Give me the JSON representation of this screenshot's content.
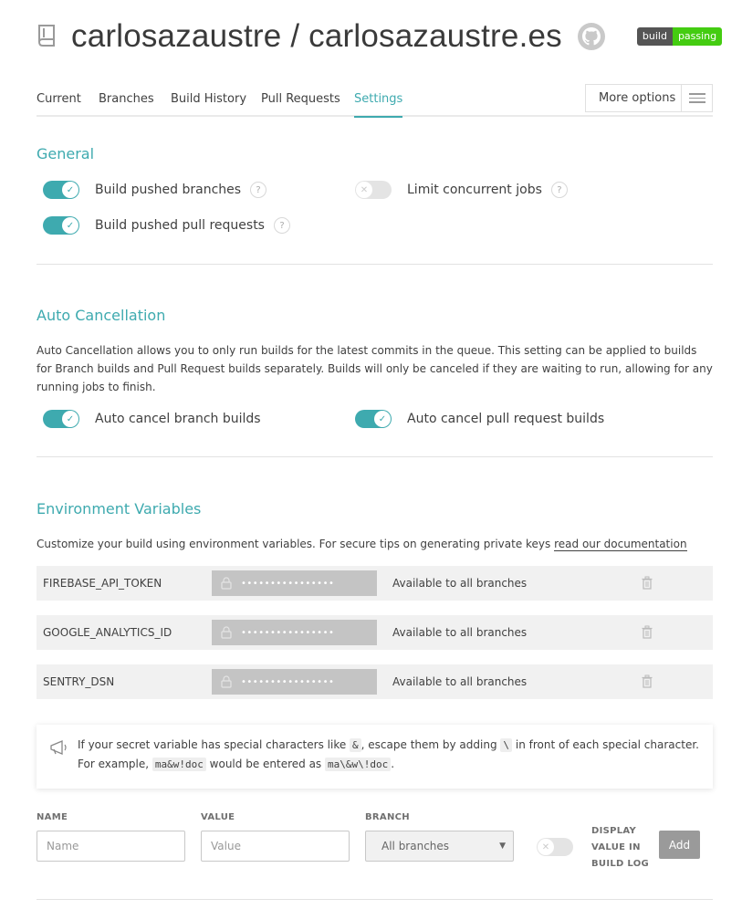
{
  "header": {
    "repo_title": "carlosazaustre / carlosazaustre.es",
    "badge_left": "build",
    "badge_right": "passing"
  },
  "tabs": [
    {
      "label": "Current"
    },
    {
      "label": "Branches"
    },
    {
      "label": "Build History"
    },
    {
      "label": "Pull Requests"
    },
    {
      "label": "Settings",
      "active": true
    }
  ],
  "more_options": "More options",
  "general": {
    "title": "General",
    "toggles": [
      {
        "label": "Build pushed branches",
        "on": true,
        "help": "?"
      },
      {
        "label": "Limit concurrent jobs",
        "on": false,
        "help": "?"
      },
      {
        "label": "Build pushed pull requests",
        "on": true,
        "help": "?"
      }
    ]
  },
  "auto_cancel": {
    "title": "Auto Cancellation",
    "description": "Auto Cancellation allows you to only run builds for the latest commits in the queue. This setting can be applied to builds for Branch builds and Pull Request builds separately. Builds will only be canceled if they are waiting to run, allowing for any running jobs to finish.",
    "toggles": [
      {
        "label": "Auto cancel branch builds",
        "on": true
      },
      {
        "label": "Auto cancel pull request builds",
        "on": true
      }
    ]
  },
  "env": {
    "title": "Environment Variables",
    "description": "Customize your build using environment variables. For secure tips on generating private keys",
    "doc_link": "read our documentation",
    "rows": [
      {
        "name": "FIREBASE_API_TOKEN",
        "value": "••••••••••••••••",
        "branch": "Available to all branches"
      },
      {
        "name": "GOOGLE_ANALYTICS_ID",
        "value": "••••••••••••••••",
        "branch": "Available to all branches"
      },
      {
        "name": "SENTRY_DSN",
        "value": "••••••••••••••••",
        "branch": "Available to all branches"
      }
    ],
    "tip": {
      "t1": "If your secret variable has special characters like",
      "c1": "&",
      "t2": ", escape them by adding",
      "c2": "\\",
      "t3": "in front of each special character. For example,",
      "c3": "ma&w!doc",
      "t4": "would be entered as",
      "c4": "ma\\&w\\!doc",
      "t5": "."
    },
    "form": {
      "name_label": "NAME",
      "name_placeholder": "Name",
      "value_label": "VALUE",
      "value_placeholder": "Value",
      "branch_label": "BRANCH",
      "branch_selected": "All branches",
      "display_label_1": "DISPLAY",
      "display_label_2": "VALUE IN",
      "display_label_3": "BUILD LOG",
      "display_on": false,
      "add_label": "Add"
    }
  },
  "colors": {
    "accent": "#3eaaaf",
    "badge_green": "#44cc11"
  }
}
